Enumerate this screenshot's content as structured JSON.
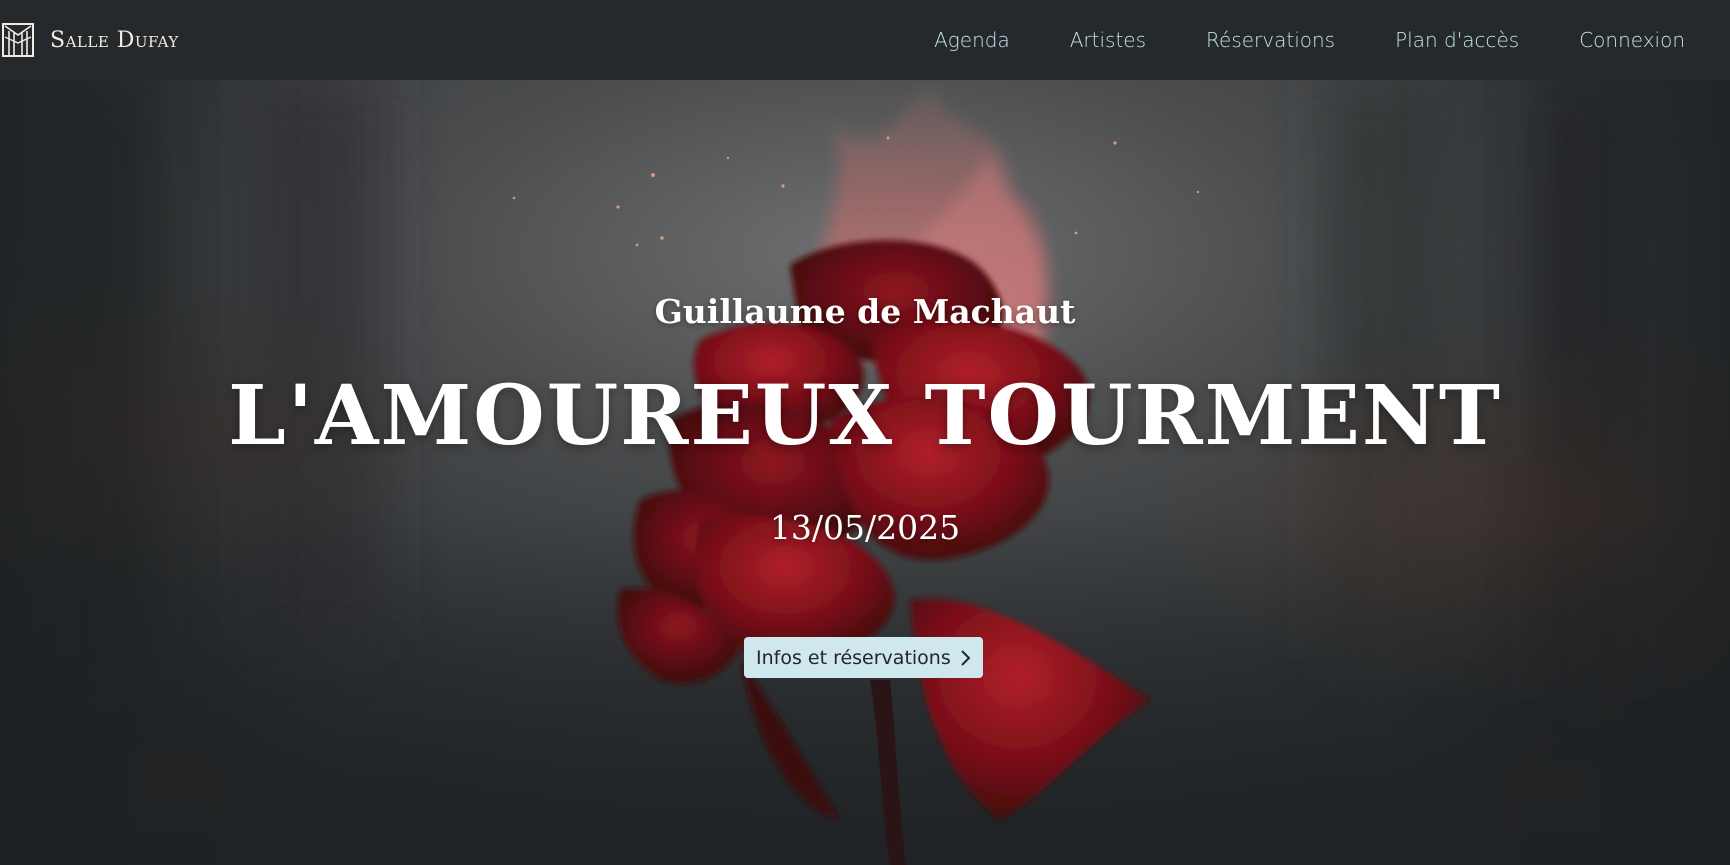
{
  "brand": {
    "name": "Salle Dufay",
    "icon": "venue-logo-icon"
  },
  "nav": {
    "items": [
      {
        "label": "Agenda"
      },
      {
        "label": "Artistes"
      },
      {
        "label": "Réservations"
      },
      {
        "label": "Plan d'accès"
      },
      {
        "label": "Connexion"
      }
    ]
  },
  "hero": {
    "subtitle": "Guillaume de Machaut",
    "title": "L'AMOUREUX TOURMENT",
    "date": "13/05/2025",
    "cta_label": "Infos et réservations",
    "cta_icon": "chevron-right-icon",
    "background_icon": "burning-rose-image"
  },
  "colors": {
    "navbar_bg": "#26292c",
    "nav_link": "#bfe4ea",
    "brand_text": "#f1ece3",
    "cta_bg": "#cfe8ee",
    "cta_text": "#23272a"
  }
}
